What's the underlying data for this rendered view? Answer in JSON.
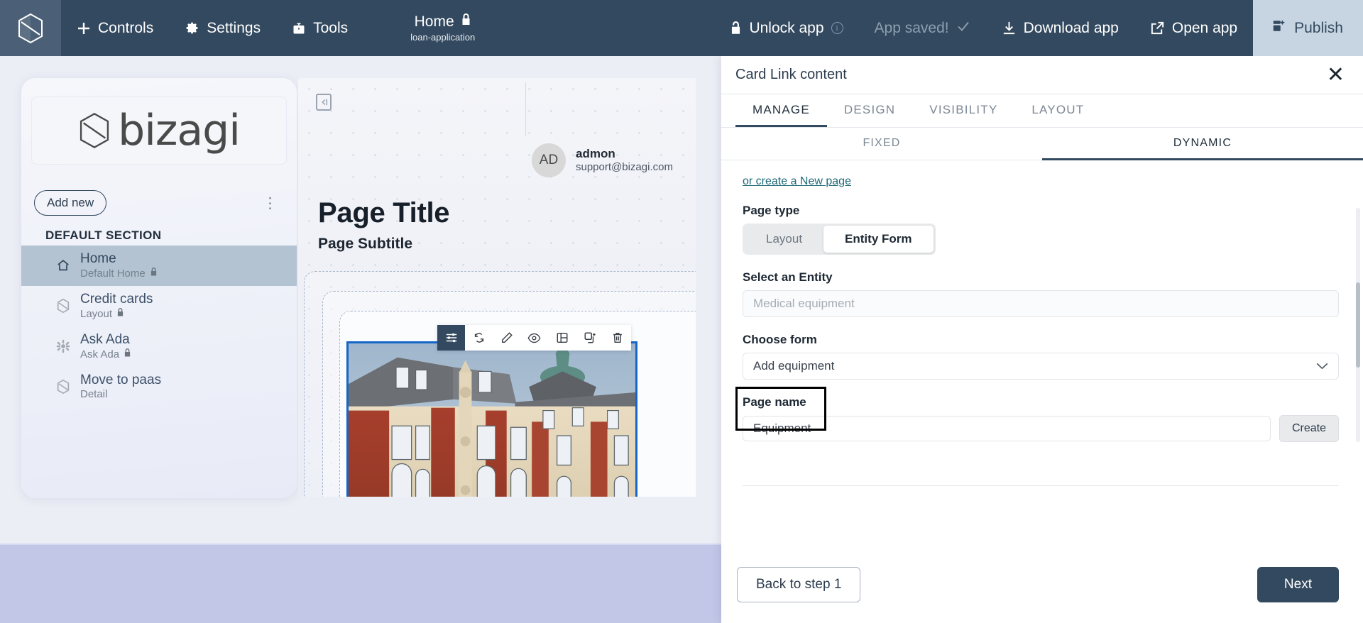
{
  "topbar": {
    "logo_icon": "bizagi-hexagon-logo",
    "nav": [
      {
        "label": "Controls",
        "icon": "plus-icon"
      },
      {
        "label": "Settings",
        "icon": "gear-icon"
      },
      {
        "label": "Tools",
        "icon": "toolbox-icon"
      }
    ],
    "page_title": "Home",
    "page_title_lock_icon": "lock-icon",
    "app_slug": "loan-application",
    "unlock_label": "Unlock app",
    "unlock_icon": "open-lock-icon",
    "unlock_info_icon": "info-icon",
    "saved_label": "App saved!",
    "saved_check_icon": "check-icon",
    "download_label": "Download app",
    "download_icon": "download-icon",
    "open_label": "Open app",
    "open_icon": "external-link-icon",
    "publish_label": "Publish",
    "publish_icon": "publish-icon",
    "bg_color": "#33495f",
    "publish_bg": "#c7d5e3"
  },
  "left_panel": {
    "logo_text": "bizagi",
    "add_new_label": "Add new",
    "kebab_icon": "more-vertical-icon",
    "section_label": "DEFAULT SECTION",
    "items": [
      {
        "title": "Home",
        "subtitle": "Default Home",
        "icon": "home-icon",
        "locked": true,
        "active": true
      },
      {
        "title": "Credit cards",
        "subtitle": "Layout",
        "icon": "hexagon-icon",
        "locked": true,
        "active": false
      },
      {
        "title": "Ask Ada",
        "subtitle": "Ask Ada",
        "icon": "asterisk-icon",
        "locked": true,
        "active": false
      },
      {
        "title": "Move to paas",
        "subtitle": "Detail",
        "icon": "hexagon-icon",
        "locked": false,
        "active": false
      }
    ]
  },
  "canvas": {
    "collapse_icon": "collapse-panel-icon",
    "avatar_initials": "AD",
    "user_name": "admon",
    "user_email": "support@bizagi.com",
    "page_title": "Page Title",
    "page_subtitle": "Page Subtitle",
    "toolbar": [
      {
        "icon": "sliders-icon",
        "name": "properties-button",
        "selected": true
      },
      {
        "icon": "refresh-icon",
        "name": "replace-button",
        "selected": false
      },
      {
        "icon": "pencil-icon",
        "name": "edit-button",
        "selected": false
      },
      {
        "icon": "eye-icon",
        "name": "preview-button",
        "selected": false
      },
      {
        "icon": "layout-icon",
        "name": "layout-button",
        "selected": false
      },
      {
        "icon": "duplicate-icon",
        "name": "duplicate-button",
        "selected": false
      },
      {
        "icon": "trash-icon",
        "name": "delete-button",
        "selected": false
      }
    ],
    "selected_border_color": "#1566c8",
    "image_alt": "baroque palace building photo"
  },
  "right_panel": {
    "title": "Card Link content",
    "close_icon": "close-icon",
    "tabs": [
      {
        "label": "MANAGE",
        "active": true
      },
      {
        "label": "DESIGN",
        "active": false
      },
      {
        "label": "VISIBILITY",
        "active": false
      },
      {
        "label": "LAYOUT",
        "active": false
      }
    ],
    "subtabs": [
      {
        "label": "FIXED",
        "active": false
      },
      {
        "label": "DYNAMIC",
        "active": true
      }
    ],
    "new_page_link": "or create a New page",
    "page_type_label": "Page type",
    "page_type_options": [
      {
        "label": "Layout",
        "selected": false
      },
      {
        "label": "Entity Form",
        "selected": true
      }
    ],
    "entity_label": "Select an Entity",
    "entity_value": "Medical equipment",
    "form_label": "Choose form",
    "form_value": "Add equipment",
    "form_chevron_icon": "chevron-down-icon",
    "page_name_label": "Page name",
    "page_name_value": "Equipment",
    "create_label": "Create",
    "back_label": "Back to step 1",
    "next_label": "Next",
    "accent_color": "#33495f",
    "link_color": "#1f6a78"
  }
}
